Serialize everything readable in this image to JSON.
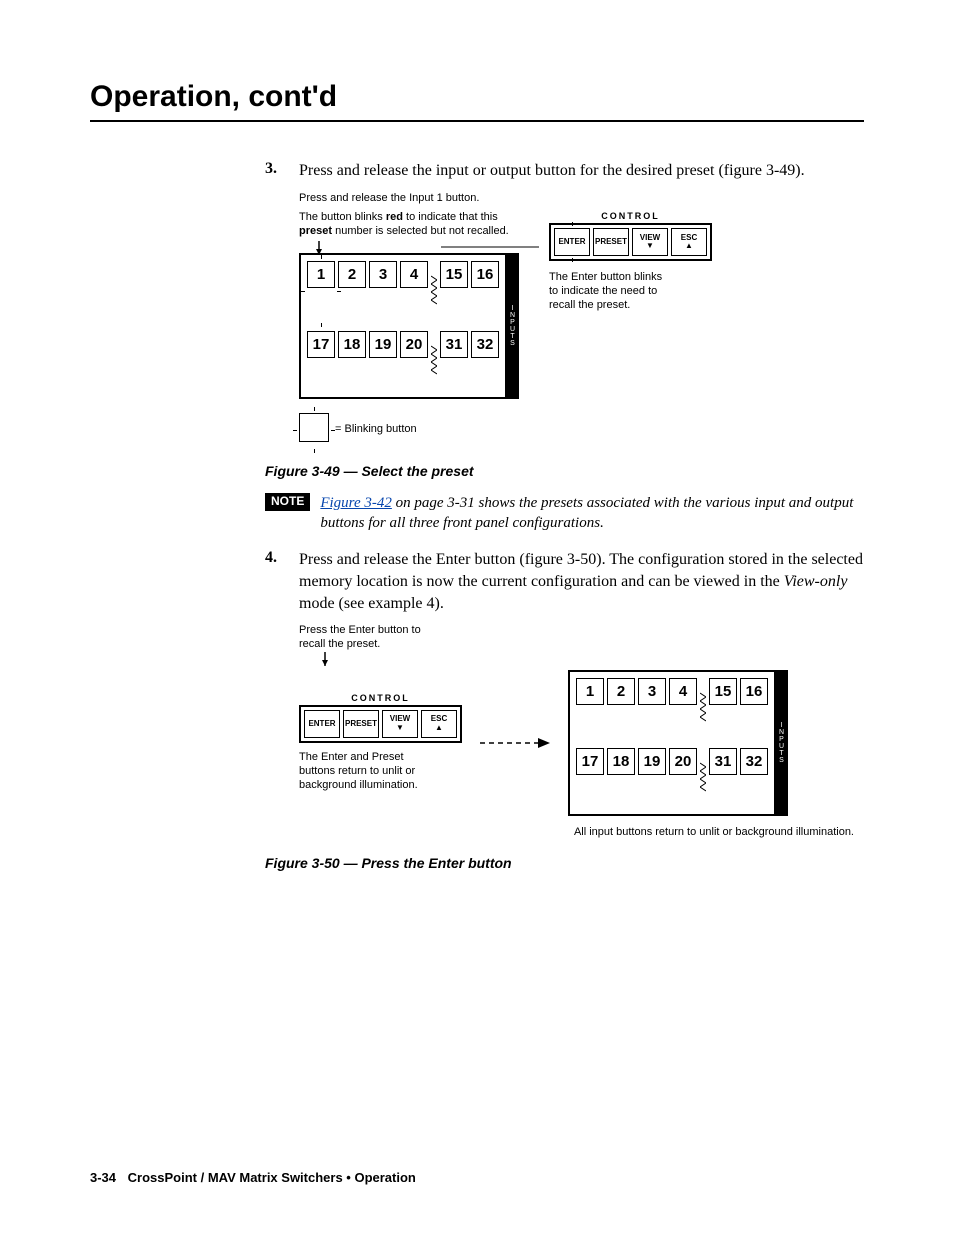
{
  "header": {
    "title": "Operation, cont'd"
  },
  "step3": {
    "num": "3.",
    "text": "Press and release the input or output button for the desired preset (figure 3-49)."
  },
  "fig49": {
    "caption": "Figure 3-49 — Select the preset",
    "l1": "Press and release the Input 1 button.",
    "l2a": "The button blinks ",
    "l2b": "red",
    "l2c": " to indicate that this",
    "l3a": "preset",
    "l3b": " number is selected but not recalled.",
    "row1": [
      "1",
      "2",
      "3",
      "4",
      "15",
      "16"
    ],
    "row2": [
      "17",
      "18",
      "19",
      "20",
      "31",
      "32"
    ],
    "inputs_label": "INPUTS",
    "legend": " = Blinking button",
    "control_label": "CONTROL",
    "ctrl_buttons": [
      "ENTER",
      "PRESET",
      "VIEW",
      "ESC"
    ],
    "right1": "The Enter button blinks",
    "right2": "to indicate the need to",
    "right3": "recall the preset."
  },
  "note": {
    "badge": "NOTE",
    "link": "Figure 3-42",
    "rest1": " on page 3-31 shows the presets associated with the various input and output buttons for all three front panel configurations."
  },
  "step4": {
    "num": "4.",
    "text1": "Press and release the Enter button (figure 3-50).  The configuration stored in the selected memory location is now the current configuration and can be viewed in the ",
    "viewonly": "View-only",
    "text2": " mode (see example 4)."
  },
  "fig50": {
    "caption": "Figure 3-50 — Press the Enter button",
    "l1": "Press the Enter button to",
    "l2": "recall the preset.",
    "control_label": "CONTROL",
    "ctrl_buttons": [
      "ENTER",
      "PRESET",
      "VIEW",
      "ESC"
    ],
    "below1": "The Enter and Preset",
    "below2": "buttons return to unlit or",
    "below3": "background illumination.",
    "row1": [
      "1",
      "2",
      "3",
      "4",
      "15",
      "16"
    ],
    "row2": [
      "17",
      "18",
      "19",
      "20",
      "31",
      "32"
    ],
    "inputs_label": "INPUTS",
    "bottom": "All input buttons return to unlit or background illumination."
  },
  "footer": {
    "page": "3-34",
    "title": "CrossPoint / MAV Matrix Switchers • Operation"
  }
}
